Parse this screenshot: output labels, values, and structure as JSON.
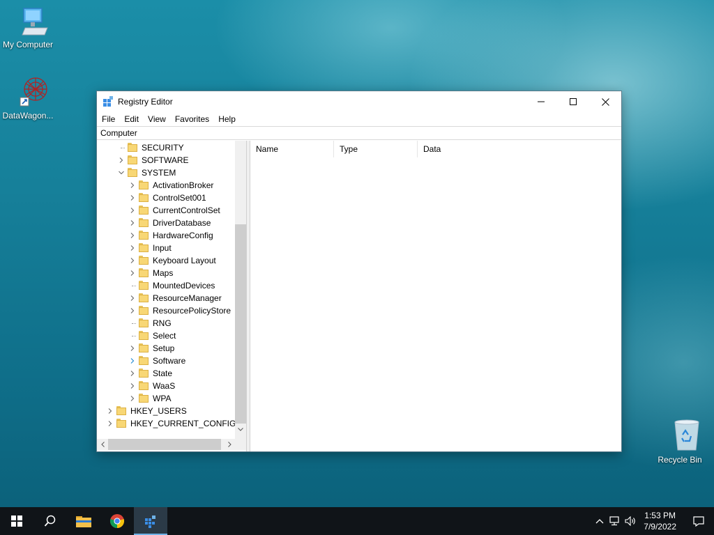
{
  "desktop": {
    "icons": [
      {
        "label": "My Computer"
      },
      {
        "label": "DataWagon..."
      },
      {
        "label": "Recycle Bin"
      }
    ]
  },
  "window": {
    "title": "Registry Editor",
    "menu": [
      "File",
      "Edit",
      "View",
      "Favorites",
      "Help"
    ],
    "address": "Computer",
    "tree": [
      {
        "label": "SECURITY",
        "expander": "none"
      },
      {
        "label": "SOFTWARE",
        "expander": "collapsed"
      },
      {
        "label": "SYSTEM",
        "expander": "expanded"
      },
      {
        "label": "ActivationBroker",
        "expander": "collapsed"
      },
      {
        "label": "ControlSet001",
        "expander": "collapsed"
      },
      {
        "label": "CurrentControlSet",
        "expander": "collapsed"
      },
      {
        "label": "DriverDatabase",
        "expander": "collapsed"
      },
      {
        "label": "HardwareConfig",
        "expander": "collapsed"
      },
      {
        "label": "Input",
        "expander": "collapsed"
      },
      {
        "label": "Keyboard Layout",
        "expander": "collapsed"
      },
      {
        "label": "Maps",
        "expander": "collapsed"
      },
      {
        "label": "MountedDevices",
        "expander": "none"
      },
      {
        "label": "ResourceManager",
        "expander": "collapsed"
      },
      {
        "label": "ResourcePolicyStore",
        "expander": "collapsed"
      },
      {
        "label": "RNG",
        "expander": "none"
      },
      {
        "label": "Select",
        "expander": "none"
      },
      {
        "label": "Setup",
        "expander": "collapsed"
      },
      {
        "label": "Software",
        "expander": "collapsed-hover"
      },
      {
        "label": "State",
        "expander": "collapsed"
      },
      {
        "label": "WaaS",
        "expander": "collapsed"
      },
      {
        "label": "WPA",
        "expander": "collapsed"
      },
      {
        "label": "HKEY_USERS",
        "expander": "collapsed"
      },
      {
        "label": "HKEY_CURRENT_CONFIG",
        "expander": "collapsed"
      }
    ],
    "columns": [
      "Name",
      "Type",
      "Data"
    ]
  },
  "taskbar": {
    "time": "1:53 PM",
    "date": "7/9/2022"
  },
  "colors": {
    "folder": "#f8d775",
    "taskbar": "#101418",
    "accent": "#6fb3e8"
  }
}
